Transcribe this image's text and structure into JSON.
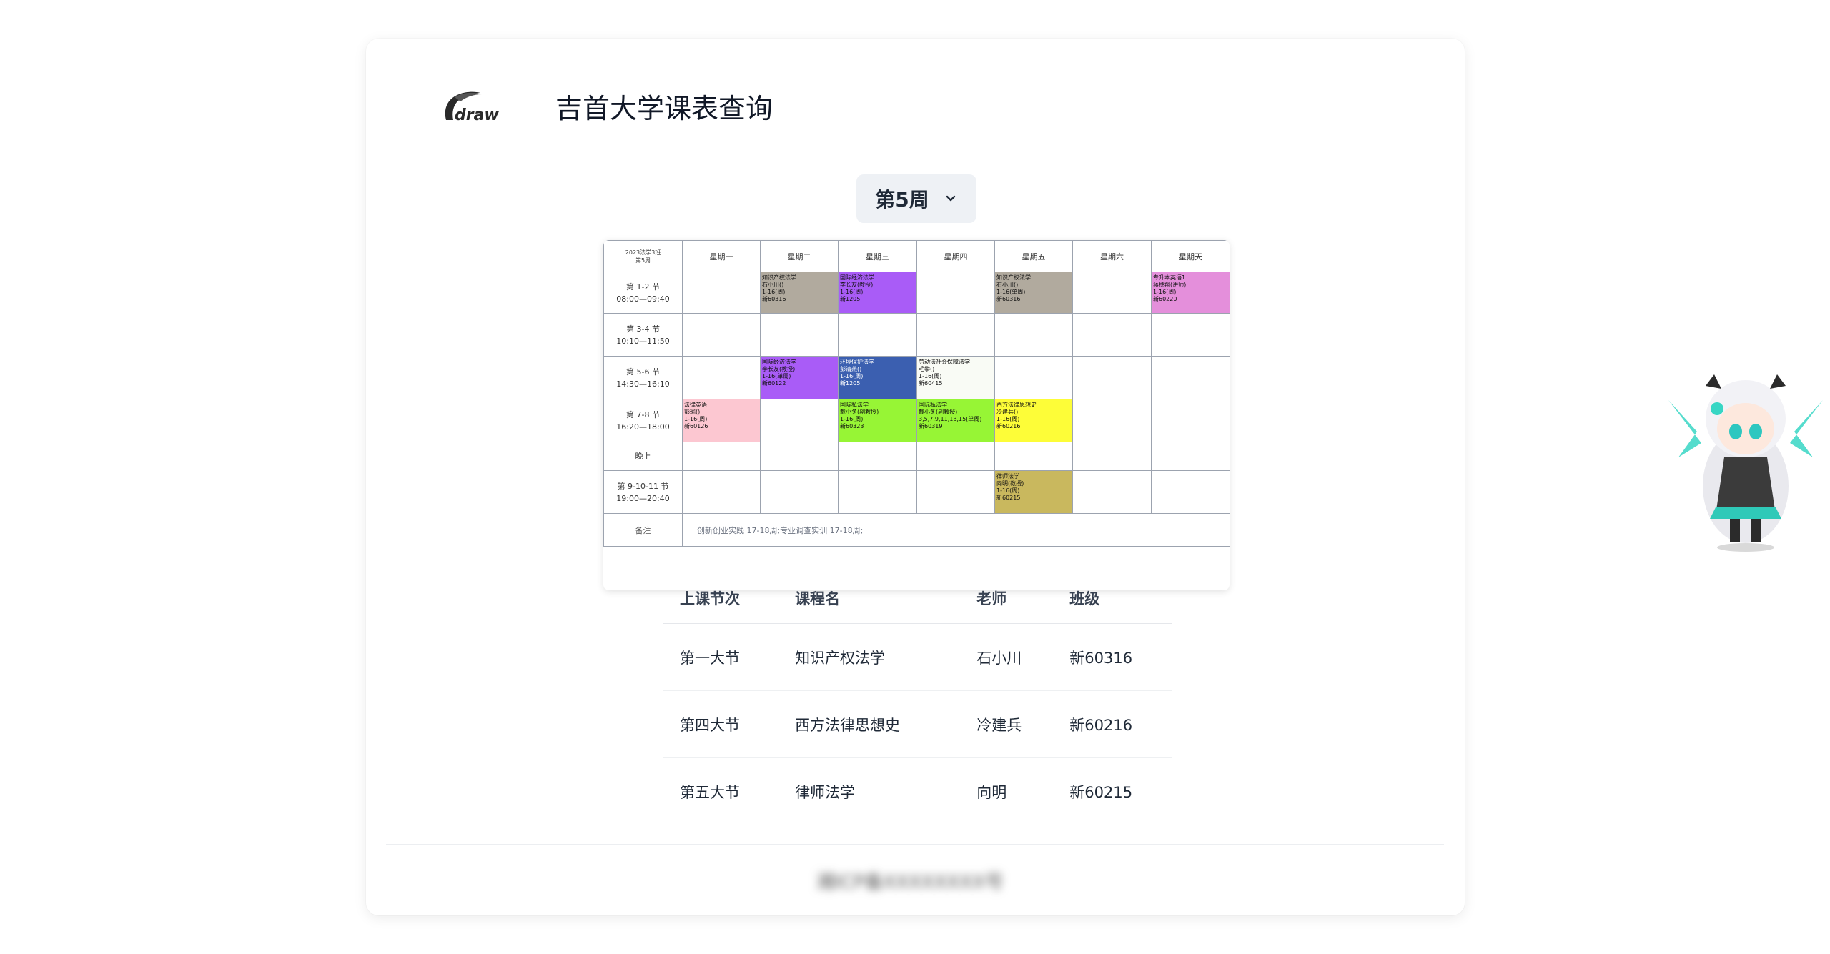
{
  "header": {
    "logo_text": "draw",
    "site_title": "吉首大学课表查询"
  },
  "week_selector": {
    "label": "第5周"
  },
  "timetable": {
    "corner": [
      "2023法学3班",
      "第5周"
    ],
    "days": [
      "星期一",
      "星期二",
      "星期三",
      "星期四",
      "星期五",
      "星期六",
      "星期天"
    ],
    "rows": [
      {
        "period": "第 1-2 节",
        "time": "08:00—09:40",
        "cells": [
          null,
          {
            "color": "#b1aa9e",
            "lines": [
              "知识产权法学",
              "石小川()",
              "1-16(周)",
              "新60316"
            ]
          },
          {
            "color": "#a95cf7",
            "lines": [
              "国际经济法学",
              "李长友(教授)",
              "1-16(周)",
              "新1205"
            ]
          },
          null,
          {
            "color": "#b1aa9e",
            "lines": [
              "知识产权法学",
              "石小川()",
              "1-16(单周)",
              "新60316"
            ]
          },
          null,
          {
            "color": "#e48fdb",
            "lines": [
              "专升本英语1",
              "蒋穗翔(讲师)",
              "1-16(周)",
              "新60220"
            ]
          }
        ]
      },
      {
        "period": "第 3-4 节",
        "time": "10:10—11:50",
        "cells": [
          null,
          null,
          null,
          null,
          null,
          null,
          null
        ]
      },
      {
        "period": "第 5-6 节",
        "time": "14:30—16:10",
        "cells": [
          null,
          {
            "color": "#a95cf7",
            "lines": [
              "国际经济法学",
              "李长友(教授)",
              "1-16(单周)",
              "新60122"
            ]
          },
          {
            "color": "#3b5fb0",
            "lines": [
              "环境保护法学",
              "彭清燕()",
              "1-16(周)",
              "新1205"
            ]
          },
          {
            "color": "#f9fbf5",
            "lines": [
              "劳动法社会保障法学",
              "毛攀()",
              "1-16(周)",
              "新60415"
            ]
          },
          null,
          null,
          null
        ]
      },
      {
        "period": "第 7-8 节",
        "time": "16:20—18:00",
        "cells": [
          {
            "color": "#fcc7d1",
            "lines": [
              "法律英语",
              "彭瑜()",
              "1-16(周)",
              "新60126"
            ]
          },
          null,
          {
            "color": "#97f535",
            "lines": [
              "国际私法学",
              "戴小冬(副教授)",
              "1-16(周)",
              "新60323"
            ]
          },
          {
            "color": "#97f535",
            "lines": [
              "国际私法学",
              "戴小冬(副教授)",
              "3,5,7,9,11,13,15(单周)",
              "新60319"
            ]
          },
          {
            "color": "#fdfd38",
            "lines": [
              "西方法律思想史",
              "冷建兵()",
              "1-16(周)",
              "新60216"
            ]
          },
          null,
          null
        ]
      },
      {
        "period": "晚上",
        "time": "",
        "cells": [
          null,
          null,
          null,
          null,
          null,
          null,
          null
        ]
      },
      {
        "period": "第 9-10-11 节",
        "time": "19:00—20:40",
        "cells": [
          null,
          null,
          null,
          null,
          {
            "color": "#c9b85e",
            "lines": [
              "律师法学",
              "向明(教授)",
              "1-16(周)",
              "新60215"
            ]
          },
          null,
          null
        ]
      }
    ],
    "note_label": "备注",
    "note": "创新创业实践  17-18周;专业调查实训  17-18周;"
  },
  "course_table": {
    "headers": [
      "上课节次",
      "课程名",
      "老师",
      "班级"
    ],
    "rows": [
      [
        "第一大节",
        "知识产权法学",
        "石小川",
        "新60316"
      ],
      [
        "第四大节",
        "西方法律思想史",
        "冷建兵",
        "新60216"
      ],
      [
        "第五大节",
        "律师法学",
        "向明",
        "新60215"
      ]
    ]
  },
  "footer": {
    "text": "湘ICP备XXXXXXXX号"
  },
  "icons": {
    "logo": "draw-logo-icon",
    "chevron": "chevron-down-icon",
    "mascot": "anime-mascot-icon"
  },
  "colors": {
    "accent_bg": "#eef1f5"
  }
}
